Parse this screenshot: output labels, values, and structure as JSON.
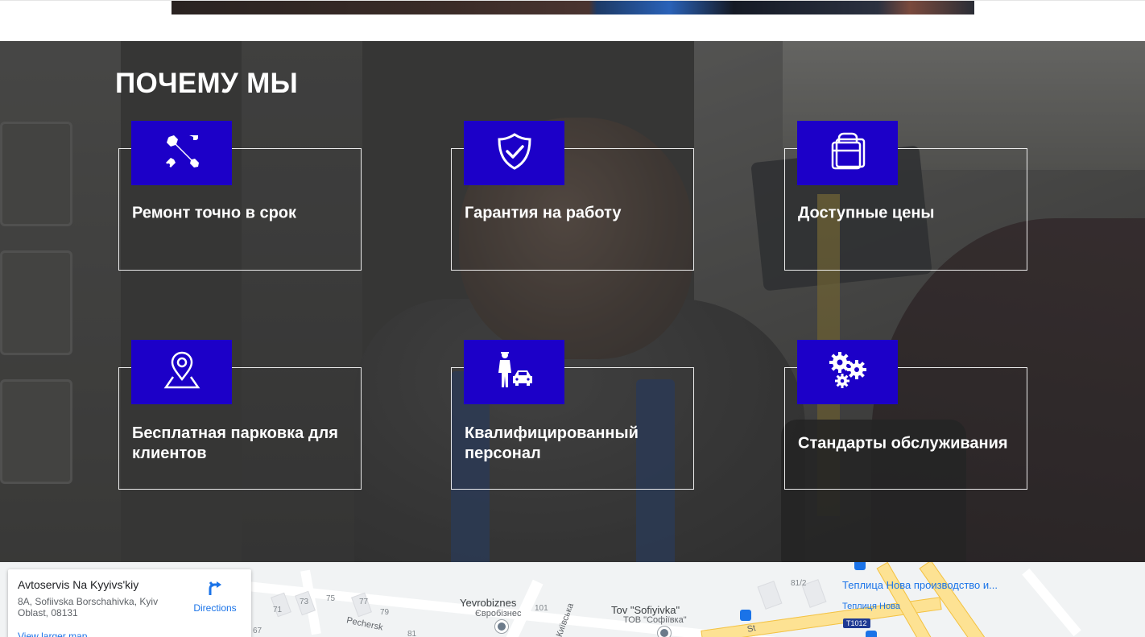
{
  "section": {
    "title": "ПОЧЕМУ МЫ",
    "accent_color": "#1c00c8"
  },
  "features": [
    {
      "label": "Ремонт точно в срок",
      "icon": "tools-icon"
    },
    {
      "label": "Гарантия на работу",
      "icon": "shield-check-icon"
    },
    {
      "label": "Доступные цены",
      "icon": "price-tag-icon"
    },
    {
      "label": "Бесплатная парковка для клиентов",
      "icon": "map-pin-icon"
    },
    {
      "label": "Квалифицированный персонал",
      "icon": "mechanic-car-icon"
    },
    {
      "label": "Стандарты обслуживания",
      "icon": "gears-icon"
    }
  ],
  "map": {
    "place_name": "Avtoservis Na Kyyivs'kiy",
    "address": "8A, Sofiivska Borschahivka, Kyiv Oblast, 08131",
    "directions_label": "Directions",
    "larger_map_label": "View larger map",
    "labels": {
      "yevrobiznes": "Yevrobiznes",
      "yevrobiznes_local": "Євробізнес",
      "tov": "Tov \"Sofiyivka\"",
      "tov_local": "ТОВ \"Софіївка\"",
      "teplytsia": "Теплица Нова производство и...",
      "teplytsia_local": "Теплиця Нова",
      "road_t1012": "T1012",
      "street_pechersk": "Pechersk",
      "street_kyivska": "Київська",
      "street_st": "St"
    },
    "numbers": [
      "71",
      "73",
      "75",
      "77",
      "79",
      "101",
      "81/2",
      "67",
      "81"
    ]
  }
}
